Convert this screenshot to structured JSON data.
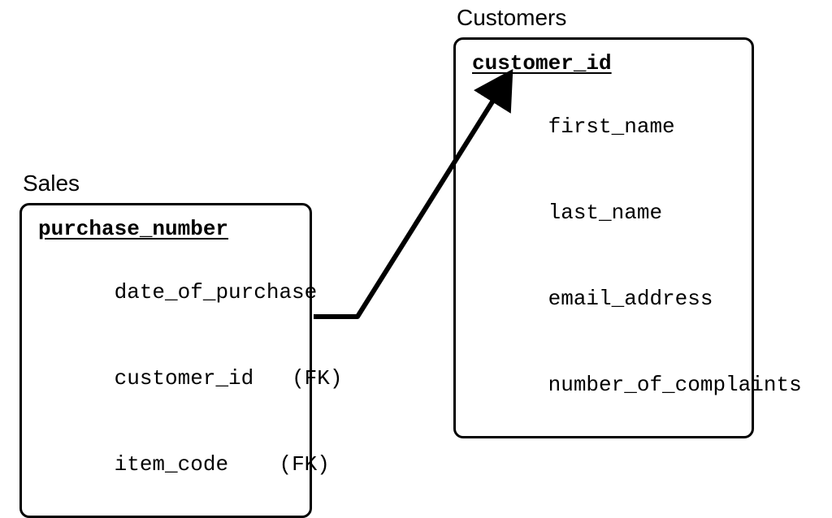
{
  "entities": {
    "sales": {
      "title": "Sales",
      "pk": "purchase_number",
      "attrs": [
        {
          "name": "date_of_purchase",
          "fk": ""
        },
        {
          "name": "customer_id",
          "fk": "   (FK)"
        },
        {
          "name": "item_code",
          "fk": "    (FK)"
        }
      ]
    },
    "customers": {
      "title": "Customers",
      "pk": "customer_id",
      "attrs": [
        {
          "name": "first_name",
          "fk": ""
        },
        {
          "name": "last_name",
          "fk": ""
        },
        {
          "name": "email_address",
          "fk": ""
        },
        {
          "name": "number_of_complaints",
          "fk": ""
        }
      ]
    }
  },
  "relationship": {
    "from": "sales.customer_id",
    "to": "customers.customer_id"
  }
}
